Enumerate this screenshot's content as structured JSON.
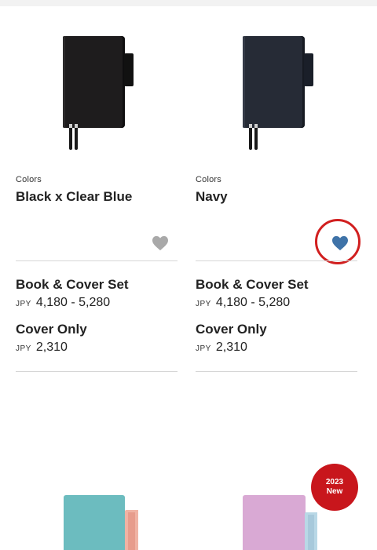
{
  "products": [
    {
      "colors_label": "Colors",
      "color_name": "Black x Clear Blue",
      "favorite": false,
      "book_cover_label": "Book & Cover Set",
      "book_cover_currency": "JPY",
      "book_cover_price": "4,180 - 5,280",
      "cover_only_label": "Cover Only",
      "cover_only_currency": "JPY",
      "cover_only_price": "2,310",
      "heart_color": "#a9a9a9"
    },
    {
      "colors_label": "Colors",
      "color_name": "Navy",
      "favorite": true,
      "book_cover_label": "Book & Cover Set",
      "book_cover_currency": "JPY",
      "book_cover_price": "4,180 - 5,280",
      "cover_only_label": "Cover Only",
      "cover_only_currency": "JPY",
      "cover_only_price": "2,310",
      "heart_color": "#3f73a8"
    }
  ],
  "badge": {
    "year": "2023",
    "label": "New",
    "color": "#c8161c"
  },
  "highlight_color": "#d11f1f"
}
